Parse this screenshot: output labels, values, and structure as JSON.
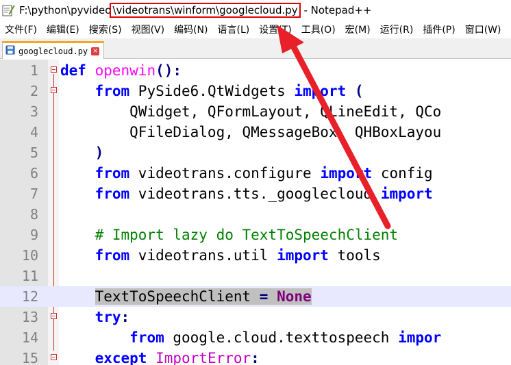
{
  "window": {
    "title_prefix": "F:\\python\\pyvideo",
    "title_highlight": "\\videotrans\\winform\\googlecloud.py",
    "title_suffix": " - Notepad++"
  },
  "menu": [
    "文件(F)",
    "编辑(E)",
    "搜索(S)",
    "视图(V)",
    "编码(N)",
    "语言(L)",
    "设置(T)",
    "工具(O)",
    "宏(M)",
    "运行(R)",
    "插件(P)",
    "窗口(W)"
  ],
  "tab": {
    "label": "googlecloud.py",
    "close_glyph": "×"
  },
  "editor": {
    "line_numbers": [
      "1",
      "2",
      "3",
      "4",
      "5",
      "6",
      "7",
      "8",
      "9",
      "10",
      "11",
      "12",
      "13",
      "14",
      "15"
    ],
    "lines": {
      "l1": {
        "kw": "def",
        "name": "openwin",
        "rest": "():"
      },
      "l2": {
        "kw": "from",
        "mod": " PySide6.QtWidgets ",
        "kw2": "import",
        "rest": " ("
      },
      "l3": {
        "text": "        QWidget, QFormLayout, QLineEdit, QCo"
      },
      "l4": {
        "text": "        QFileDialog, QMessageBox, QHBoxLayou"
      },
      "l5": {
        "text": "    )"
      },
      "l6": {
        "kw": "from",
        "mod": " videotrans.configure ",
        "kw2": "import",
        "rest": " config"
      },
      "l7": {
        "kw": "from",
        "mod": " videotrans.tts._googlecloud ",
        "kw2": "import"
      },
      "l9": {
        "comment": "# Import lazy do TextToSpeechClient"
      },
      "l10": {
        "kw": "from",
        "mod": " videotrans.util ",
        "kw2": "import",
        "rest": " tools"
      },
      "l12": {
        "name": "TextToSpeechClient",
        "op": " = ",
        "val": "None"
      },
      "l13": {
        "kw": "try",
        "rest": ":"
      },
      "l14": {
        "kw": "from",
        "mod": " google.cloud.texttospeech ",
        "kw2": "impor"
      },
      "l15": {
        "kw": "except",
        "exc": "ImportError",
        "rest": ":"
      }
    }
  },
  "colors": {
    "highlight_box": "#e00000",
    "arrow": "#e8202a"
  }
}
